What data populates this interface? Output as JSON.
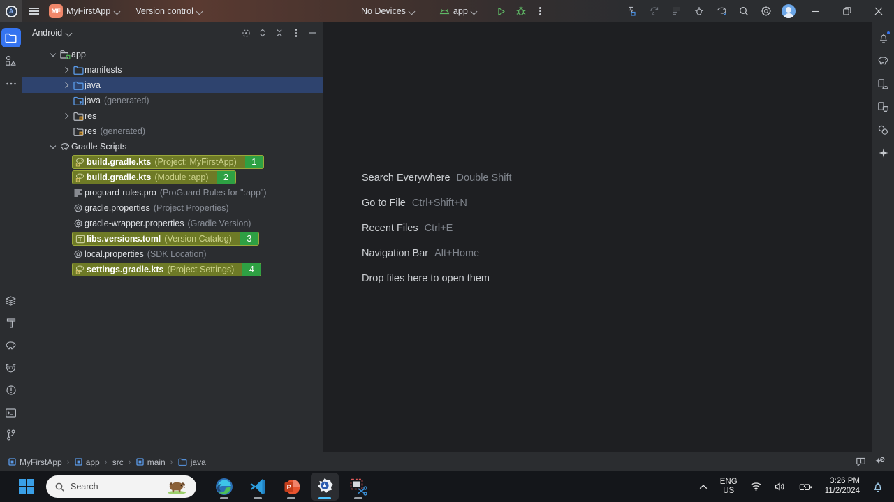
{
  "titlebar": {
    "app_icon": "android-studio-logo",
    "menu_icon": "hamburger-menu-icon",
    "project_badge": "MF",
    "project_name": "MyFirstApp",
    "version_control": "Version control",
    "device_selector": "No Devices",
    "run_config": "app",
    "run_icon": "run-play-icon",
    "debug_icon": "debug-bug-icon",
    "more_icon": "more-vertical-icon",
    "right_icons": [
      {
        "name": "app-inspection-icon"
      },
      {
        "name": "logcat-restart-icon"
      },
      {
        "name": "device-file-explorer-icon"
      },
      {
        "name": "profiler-icon"
      },
      {
        "name": "device-manager-icon"
      },
      {
        "name": "search-icon"
      },
      {
        "name": "settings-gear-icon"
      }
    ],
    "avatar": "user-avatar",
    "minimize": "minimize-icon",
    "maximize": "maximize-restore-icon",
    "close": "close-icon"
  },
  "left_strip": {
    "top_items": [
      {
        "name": "project-tool-window",
        "icon": "folder-icon",
        "active": true
      },
      {
        "name": "commit-tool-window",
        "icon": "commit-shapes-icon",
        "active": false
      },
      {
        "name": "more-tool-windows",
        "icon": "ellipsis-icon",
        "active": false
      }
    ],
    "bottom_items": [
      {
        "name": "build-variants",
        "icon": "layers-icon"
      },
      {
        "name": "build-tool-window",
        "icon": "hammer-icon"
      },
      {
        "name": "gradle-tool-window",
        "icon": "gradle-elephant-icon"
      },
      {
        "name": "app-quality-insights",
        "icon": "cat-face-icon"
      },
      {
        "name": "problems-tool-window",
        "icon": "warning-circle-icon"
      },
      {
        "name": "terminal-tool-window",
        "icon": "terminal-icon"
      },
      {
        "name": "version-control-tool-window",
        "icon": "git-branch-icon"
      }
    ]
  },
  "right_strip": {
    "items": [
      {
        "name": "notifications",
        "icon": "bell-icon",
        "badge": true
      },
      {
        "name": "gradle",
        "icon": "gradle-elephant-icon",
        "badge": false
      },
      {
        "name": "device-manager",
        "icon": "device-manager-icon",
        "badge": false
      },
      {
        "name": "running-devices",
        "icon": "running-devices-icon",
        "badge": false
      },
      {
        "name": "device-streaming",
        "icon": "device-streaming-icon",
        "badge": false
      },
      {
        "name": "gemini-assistant",
        "icon": "sparkle-icon",
        "badge": false
      }
    ]
  },
  "project_panel": {
    "title": "Android",
    "title_chevron": "chevron-down-icon",
    "actions": [
      {
        "name": "select-opened-file",
        "icon": "crosshair-target-icon"
      },
      {
        "name": "expand-collapse",
        "icon": "expand-collapse-icon"
      },
      {
        "name": "collapse-all",
        "icon": "collapse-all-icon"
      },
      {
        "name": "panel-options",
        "icon": "more-vertical-icon"
      },
      {
        "name": "hide-panel",
        "icon": "minimize-dash-icon"
      }
    ],
    "tree": [
      {
        "name": "app",
        "sub": "",
        "depth": 0,
        "arrow": "down",
        "icon": "module-folder-icon",
        "state": "normal"
      },
      {
        "name": "manifests",
        "sub": "",
        "depth": 1,
        "arrow": "right",
        "icon": "folder-blue-icon",
        "state": "normal"
      },
      {
        "name": "java",
        "sub": "",
        "depth": 1,
        "arrow": "right",
        "icon": "folder-blue-icon",
        "state": "selected"
      },
      {
        "name": "java",
        "sub": "(generated)",
        "depth": 1,
        "arrow": "none",
        "icon": "folder-generated-icon",
        "state": "normal"
      },
      {
        "name": "res",
        "sub": "",
        "depth": 1,
        "arrow": "right",
        "icon": "folder-res-icon",
        "state": "normal"
      },
      {
        "name": "res",
        "sub": "(generated)",
        "depth": 1,
        "arrow": "none",
        "icon": "folder-res-icon",
        "state": "normal"
      },
      {
        "name": "Gradle Scripts",
        "sub": "",
        "depth": 0,
        "arrow": "down",
        "icon": "gradle-elephant-icon",
        "state": "normal"
      },
      {
        "name": "build.gradle.kts",
        "sub": "(Project: MyFirstApp)",
        "depth": 1,
        "arrow": "none",
        "icon": "gradle-file-icon",
        "state": "highlight",
        "badge": "1"
      },
      {
        "name": "build.gradle.kts",
        "sub": "(Module :app)",
        "depth": 1,
        "arrow": "none",
        "icon": "gradle-file-icon",
        "state": "highlight",
        "badge": "2"
      },
      {
        "name": "proguard-rules.pro",
        "sub": "(ProGuard Rules for \":app\")",
        "depth": 1,
        "arrow": "none",
        "icon": "text-file-icon",
        "state": "normal"
      },
      {
        "name": "gradle.properties",
        "sub": "(Project Properties)",
        "depth": 1,
        "arrow": "none",
        "icon": "properties-gear-icon",
        "state": "normal"
      },
      {
        "name": "gradle-wrapper.properties",
        "sub": "(Gradle Version)",
        "depth": 1,
        "arrow": "none",
        "icon": "properties-gear-icon",
        "state": "normal"
      },
      {
        "name": "libs.versions.toml",
        "sub": "(Version Catalog)",
        "depth": 1,
        "arrow": "none",
        "icon": "toml-file-icon",
        "state": "highlight",
        "badge": "3"
      },
      {
        "name": "local.properties",
        "sub": "(SDK Location)",
        "depth": 1,
        "arrow": "none",
        "icon": "properties-gear-icon",
        "state": "normal"
      },
      {
        "name": "settings.gradle.kts",
        "sub": "(Project Settings)",
        "depth": 1,
        "arrow": "none",
        "icon": "gradle-file-icon",
        "state": "highlight",
        "badge": "4"
      }
    ]
  },
  "editor": {
    "hints": [
      {
        "label": "Search Everywhere",
        "key": "Double Shift"
      },
      {
        "label": "Go to File",
        "key": "Ctrl+Shift+N"
      },
      {
        "label": "Recent Files",
        "key": "Ctrl+E"
      },
      {
        "label": "Navigation Bar",
        "key": "Alt+Home"
      }
    ],
    "drop_hint": "Drop files here to open them"
  },
  "statusbar": {
    "breadcrumbs": [
      {
        "label": "MyFirstApp",
        "icon": "module-square-icon"
      },
      {
        "label": "app",
        "icon": "module-square-icon"
      },
      {
        "label": "src",
        "icon": "none"
      },
      {
        "label": "main",
        "icon": "module-square-icon"
      },
      {
        "label": "java",
        "icon": "folder-blue-icon"
      }
    ],
    "separator": "›",
    "right_icons": [
      {
        "name": "event-log-icon"
      },
      {
        "name": "code-with-me-icon"
      }
    ]
  },
  "taskbar": {
    "start_button": "windows-start-icon",
    "search": {
      "placeholder": "Search",
      "icon": "search-icon",
      "illustration": "bison-doodle-icon"
    },
    "apps": [
      {
        "name": "microsoft-edge",
        "icon": "edge-icon",
        "state": "running"
      },
      {
        "name": "visual-studio-code",
        "icon": "vscode-icon",
        "state": "running"
      },
      {
        "name": "powerpoint",
        "icon": "powerpoint-icon",
        "state": "running"
      },
      {
        "name": "android-studio",
        "icon": "android-studio-icon",
        "state": "active"
      },
      {
        "name": "snipping-tool",
        "icon": "snipping-tool-icon",
        "state": "running"
      }
    ],
    "tray": {
      "overflow_icon": "chevron-up-icon",
      "language_line1": "ENG",
      "language_line2": "US",
      "wifi_icon": "wifi-icon",
      "volume_icon": "speaker-icon",
      "battery_icon": "battery-charging-icon",
      "time": "3:26 PM",
      "date": "11/2/2024",
      "notification_icon": "bell-icon"
    }
  },
  "colors": {
    "accent_blue": "#3574f0",
    "selection_blue": "#2e436e",
    "highlight_olive": "#6e7a26",
    "badge_green": "#2ea043",
    "panel_bg": "#2b2d30",
    "editor_bg": "#1e1f22",
    "project_badge": "#f0876a"
  }
}
